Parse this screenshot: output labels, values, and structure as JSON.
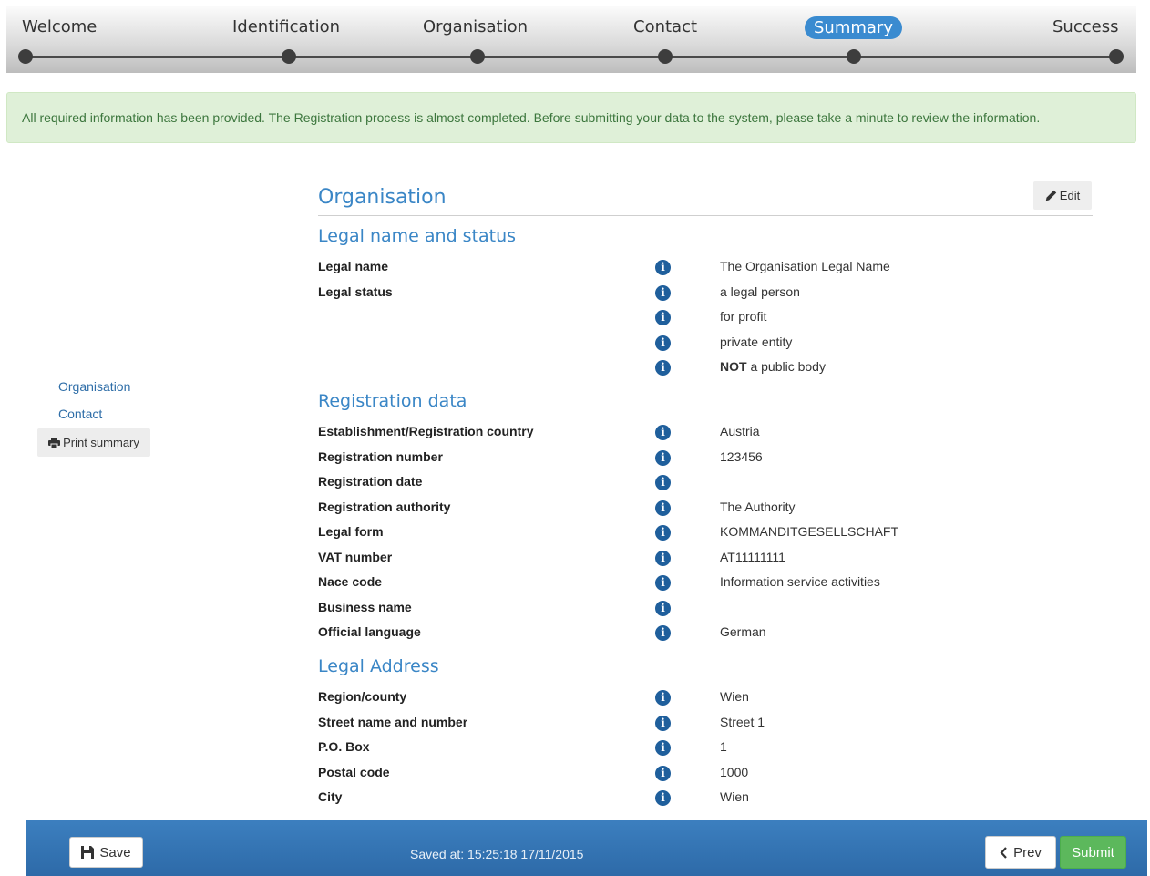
{
  "stepper": {
    "steps": [
      {
        "label": "Welcome"
      },
      {
        "label": "Identification"
      },
      {
        "label": "Organisation"
      },
      {
        "label": "Contact"
      },
      {
        "label": "Summary",
        "active": true
      },
      {
        "label": "Success"
      }
    ]
  },
  "alert": {
    "text": "All required information has been provided. The Registration process is almost completed. Before submitting your data to the system, please take a minute to review the information."
  },
  "sidenav": {
    "items": [
      "Organisation",
      "Contact"
    ],
    "print_label": "Print summary"
  },
  "section": {
    "title": "Organisation",
    "edit_label": "Edit"
  },
  "legal": {
    "heading": "Legal name and status",
    "rows": [
      {
        "label": "Legal name",
        "value": "The Organisation Legal Name"
      },
      {
        "label": "Legal status",
        "value": "a legal person"
      },
      {
        "label": "",
        "value": "for profit"
      },
      {
        "label": "",
        "value": "private entity"
      },
      {
        "label": "",
        "value_bold": "NOT",
        "value": " a public body"
      }
    ]
  },
  "registration": {
    "heading": "Registration data",
    "rows": [
      {
        "label": "Establishment/Registration country",
        "value": "Austria"
      },
      {
        "label": "Registration number",
        "value": "123456"
      },
      {
        "label": "Registration date",
        "value": ""
      },
      {
        "label": "Registration authority",
        "value": "The Authority"
      },
      {
        "label": "Legal form",
        "value": "KOMMANDITGESELLSCHAFT"
      },
      {
        "label": "VAT number",
        "value": "AT11111111"
      },
      {
        "label": "Nace code",
        "value": "Information service activities"
      },
      {
        "label": "Business name",
        "value": ""
      },
      {
        "label": "Official language",
        "value": "German"
      }
    ]
  },
  "address": {
    "heading": "Legal Address",
    "rows": [
      {
        "label": "Region/county",
        "value": "Wien"
      },
      {
        "label": "Street name and number",
        "value": "Street 1"
      },
      {
        "label": "P.O. Box",
        "value": "1"
      },
      {
        "label": "Postal code",
        "value": "1000"
      },
      {
        "label": "City",
        "value": "Wien"
      }
    ]
  },
  "footer": {
    "save_label": "Save",
    "saved_at": "Saved at: 15:25:18 17/11/2015",
    "prev_label": "Prev",
    "submit_label": "Submit"
  },
  "colors": {
    "accent": "#3a86c6",
    "active_step": "#3a8bd0",
    "alert_bg": "#dff0d8",
    "alert_text": "#3c763d",
    "footer_bg": "#2d6aa8",
    "submit": "#5cb85c",
    "info_icon": "#1f5f9c"
  }
}
